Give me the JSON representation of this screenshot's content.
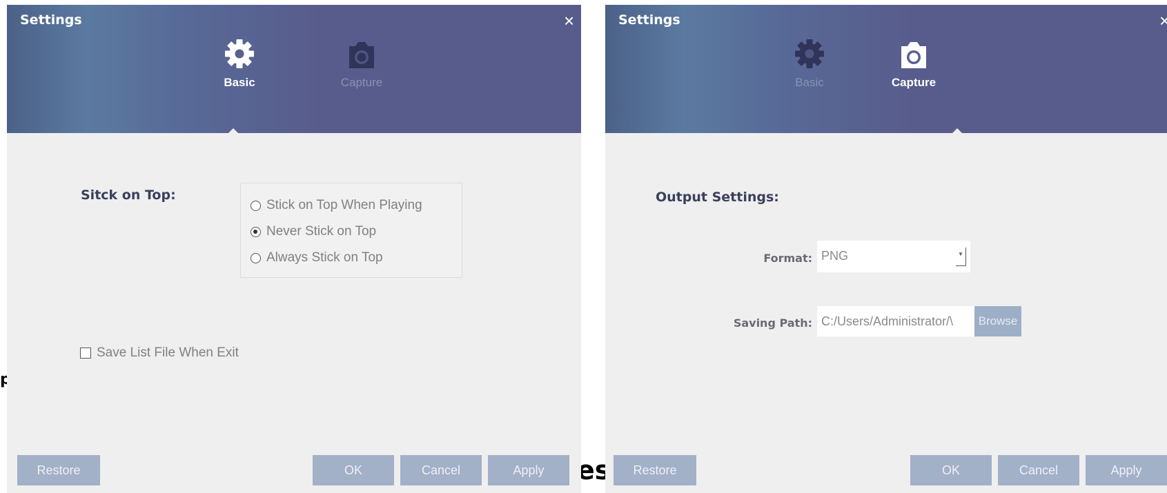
{
  "background_fragments": {
    "left": "p",
    "middle": "es"
  },
  "left_dialog": {
    "title": "Settings",
    "close_glyph": "×",
    "tabs": [
      {
        "label": "Basic",
        "icon": "gear-icon",
        "active": true
      },
      {
        "label": "Capture",
        "icon": "camera-icon",
        "active": false
      }
    ],
    "stick_on_top": {
      "label": "Sitck on Top:",
      "options": [
        {
          "label": "Stick on Top When Playing",
          "checked": false
        },
        {
          "label": "Never Stick on Top",
          "checked": true
        },
        {
          "label": "Always Stick on Top",
          "checked": false
        }
      ]
    },
    "save_list": {
      "label": "Save List File When Exit",
      "checked": false
    },
    "buttons": {
      "restore": "Restore",
      "ok": "OK",
      "cancel": "Cancel",
      "apply": "Apply"
    }
  },
  "right_dialog": {
    "title": "Settings",
    "close_glyph": "×",
    "tabs": [
      {
        "label": "Basic",
        "icon": "gear-icon",
        "active": false
      },
      {
        "label": "Capture",
        "icon": "camera-icon",
        "active": true
      }
    ],
    "output_settings": {
      "label": "Output Settings:",
      "format_label": "Format:",
      "format_value": "PNG",
      "path_label": "Saving Path:",
      "path_value": "C:/Users/Administrator/\\",
      "browse_label": "Browse"
    },
    "buttons": {
      "restore": "Restore",
      "ok": "OK",
      "cancel": "Cancel",
      "apply": "Apply"
    }
  },
  "colors": {
    "header": "#585c8c",
    "button": "#a2b0c8",
    "body": "#efeff0"
  }
}
